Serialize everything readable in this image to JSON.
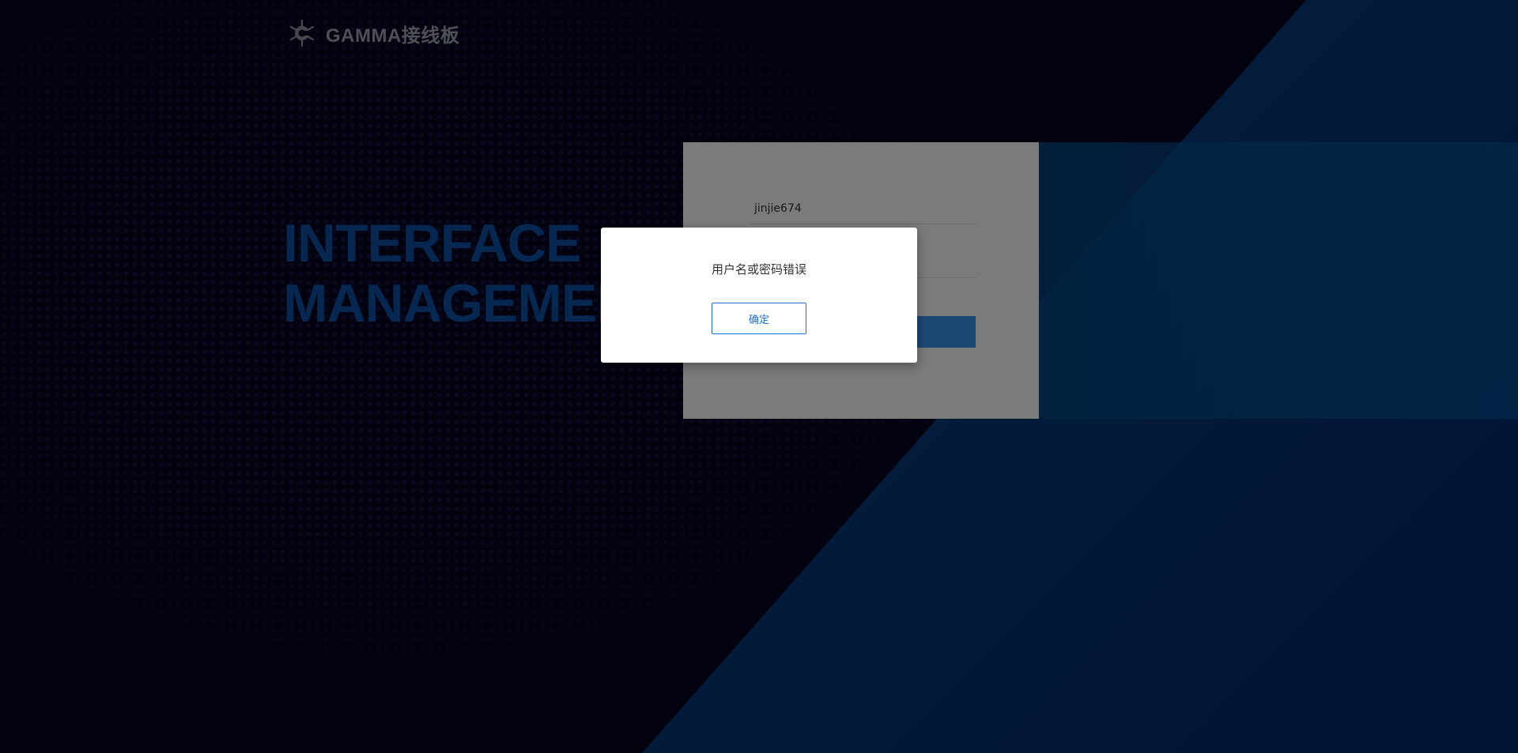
{
  "header": {
    "logo_icon": "gamma-logo-icon",
    "title": "GAMMA接线板"
  },
  "hero": {
    "line1": "INTERFACE",
    "line2": "MANAGEMENT"
  },
  "login": {
    "username_value": "jinjie674",
    "password_value": "",
    "submit_label": ""
  },
  "dialog": {
    "message": "用户名或密码错误",
    "confirm_label": "确定"
  },
  "colors": {
    "background": "#07041f",
    "accent_blue": "#0c4fa0",
    "dialog_button": "#1f6fd1"
  }
}
